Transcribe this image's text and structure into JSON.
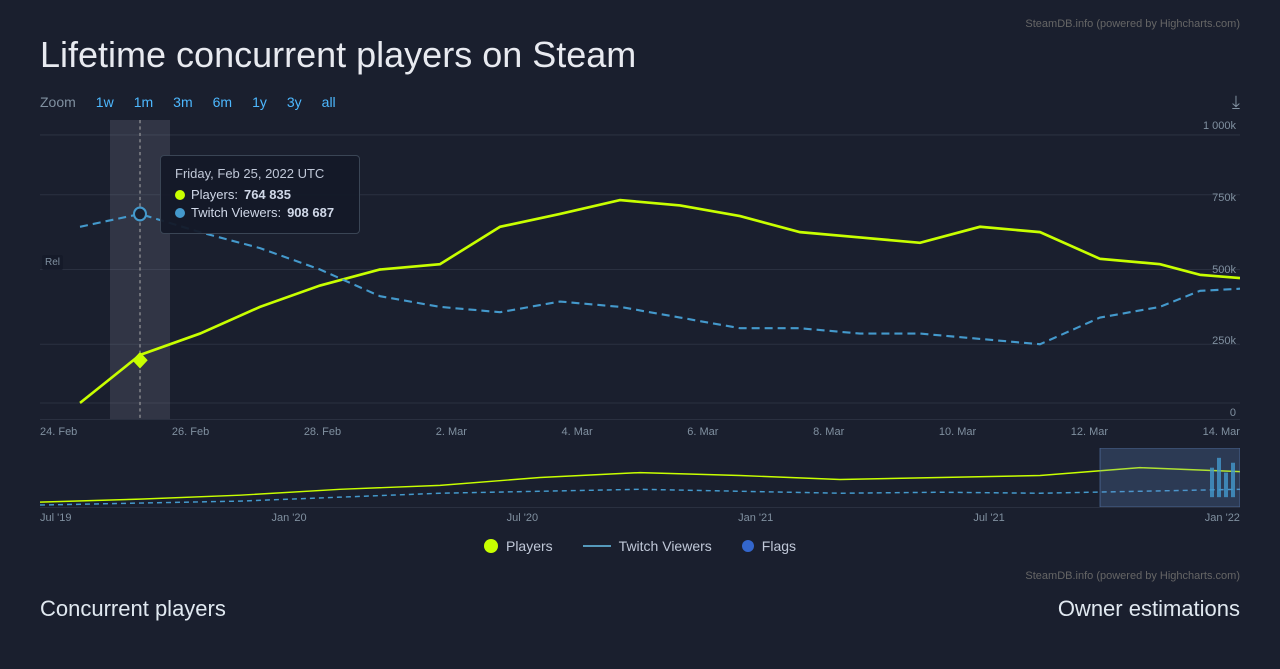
{
  "attribution": "SteamDB.info (powered by Highcharts.com)",
  "title": "Lifetime concurrent players on Steam",
  "zoom": {
    "label": "Zoom",
    "options": [
      "1w",
      "1m",
      "3m",
      "6m",
      "1y",
      "3y",
      "all"
    ]
  },
  "tooltip": {
    "date": "Friday, Feb 25, 2022 UTC",
    "players_label": "Players:",
    "players_value": "764 835",
    "twitch_label": "Twitch Viewers:",
    "twitch_value": "908 687"
  },
  "y_axis": [
    "1 000k",
    "750k",
    "500k",
    "250k",
    "0"
  ],
  "x_axis_main": [
    "24. Feb",
    "26. Feb",
    "28. Feb",
    "2. Mar",
    "4. Mar",
    "6. Mar",
    "8. Mar",
    "10. Mar",
    "12. Mar",
    "14. Mar"
  ],
  "x_axis_mini": [
    "Jul '19",
    "Jan '20",
    "Jul '20",
    "Jan '21",
    "Jul '21",
    "Jan '22"
  ],
  "legend": {
    "players_label": "Players",
    "twitch_label": "Twitch Viewers",
    "flags_label": "Flags"
  },
  "bottom": {
    "concurrent_label": "Concurrent players",
    "owner_label": "Owner estimations"
  }
}
